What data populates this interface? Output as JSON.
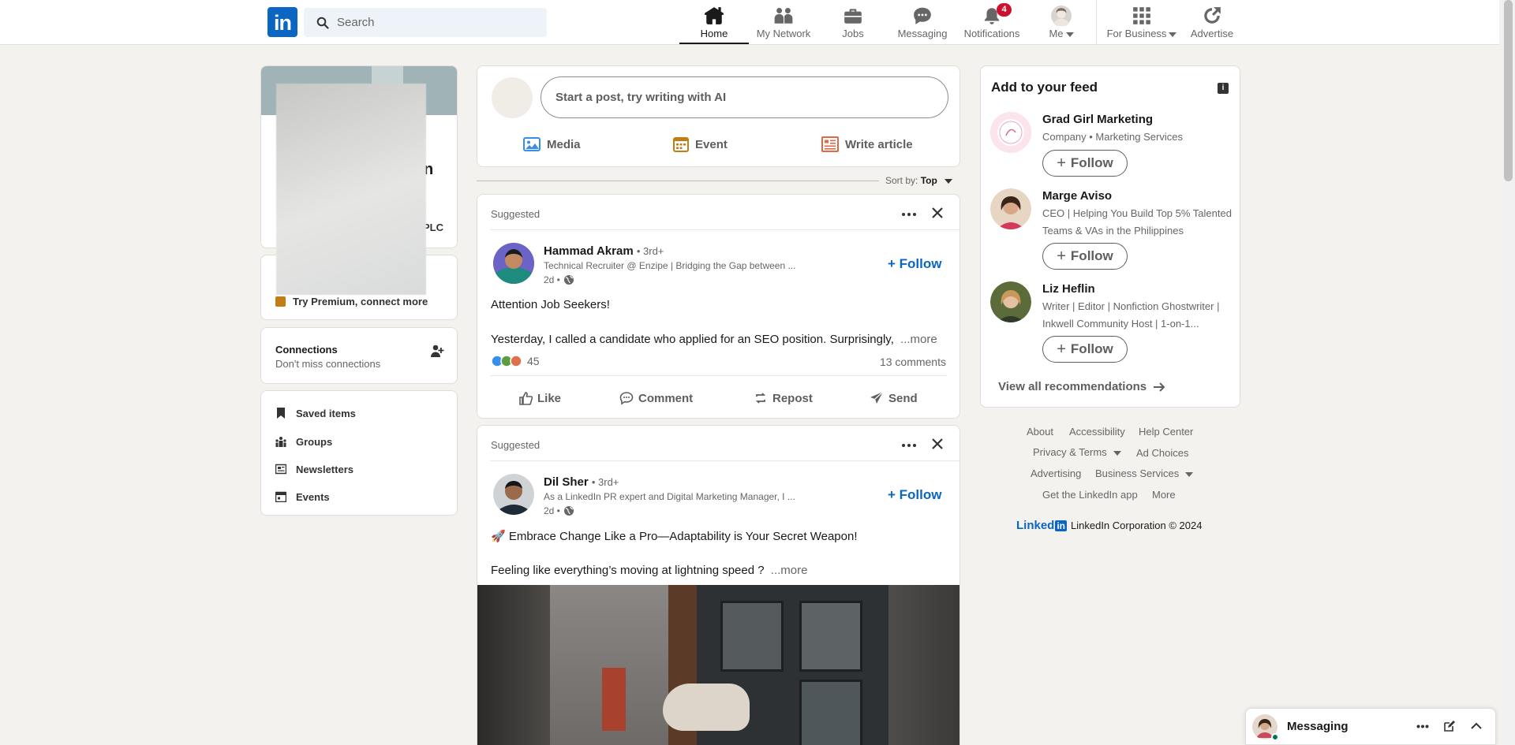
{
  "header": {
    "logo_text": "in",
    "search_placeholder": "Search",
    "nav": {
      "home": "Home",
      "network": "My Network",
      "jobs": "Jobs",
      "messaging": "Messaging",
      "notifications": "Notifications",
      "notifications_count": "4",
      "me": "Me",
      "business": "For Business",
      "advertise": "Advertise"
    }
  },
  "left": {
    "profile": {
      "name_fragment": "n",
      "company_fragment": "PLC",
      "premium_text": "Try Premium, connect more"
    },
    "connections": {
      "title": "Connections",
      "subtitle": "Don't miss connections"
    },
    "links": [
      "Saved items",
      "Groups",
      "Newsletters",
      "Events"
    ]
  },
  "composer": {
    "placeholder": "Start a post, try writing with AI",
    "media": "Media",
    "event": "Event",
    "article": "Write article"
  },
  "sort": {
    "label": "Sort by:",
    "value": "Top"
  },
  "posts": [
    {
      "label": "Suggested",
      "name": "Hammad Akram",
      "degree": "• 3rd+",
      "headline": "Technical Recruiter @ Enzipe | Bridging the Gap between ...",
      "time": "2d •",
      "follow": "Follow",
      "line1": "Attention Job Seekers!",
      "line2": "Yesterday, I called a candidate who applied for an SEO position. Surprisingly,",
      "more": "...more",
      "reactions": "45",
      "comments": "13 comments",
      "actions": {
        "like": "Like",
        "comment": "Comment",
        "repost": "Repost",
        "send": "Send"
      }
    },
    {
      "label": "Suggested",
      "name": "Dil Sher",
      "degree": "• 3rd+",
      "headline": "As a LinkedIn PR expert and Digital Marketing Manager, I ...",
      "time": "2d •",
      "follow": "Follow",
      "line1": "🚀 Embrace Change Like a Pro—Adaptability is Your Secret Weapon!",
      "line2": "Feeling like everything’s moving at lightning speed ?",
      "more": "...more"
    }
  ],
  "feed_recs": {
    "title": "Add to your feed",
    "items": [
      {
        "name": "Grad Girl Marketing",
        "sub": "Company • Marketing Services",
        "button": "Follow"
      },
      {
        "name": "Marge Aviso",
        "sub": "CEO | Helping You Build Top 5% Talented Teams & VAs in the Philippines",
        "button": "Follow"
      },
      {
        "name": "Liz Heflin",
        "sub": "Writer | Editor | Nonfiction Ghostwriter | Inkwell Community Host | 1-on-1...",
        "button": "Follow"
      }
    ],
    "view_all": "View all recommendations"
  },
  "footer": {
    "about": "About",
    "accessibility": "Accessibility",
    "help": "Help Center",
    "privacy": "Privacy & Terms",
    "ad_choices": "Ad Choices",
    "advertising": "Advertising",
    "business_services": "Business Services",
    "app": "Get the LinkedIn app",
    "more": "More",
    "brand": "Linked",
    "copyright": "LinkedIn Corporation © 2024"
  },
  "messaging": {
    "label": "Messaging"
  },
  "colors": {
    "brand": "#0a66c2",
    "badge": "#cb112d",
    "background": "#f4f2ee"
  }
}
